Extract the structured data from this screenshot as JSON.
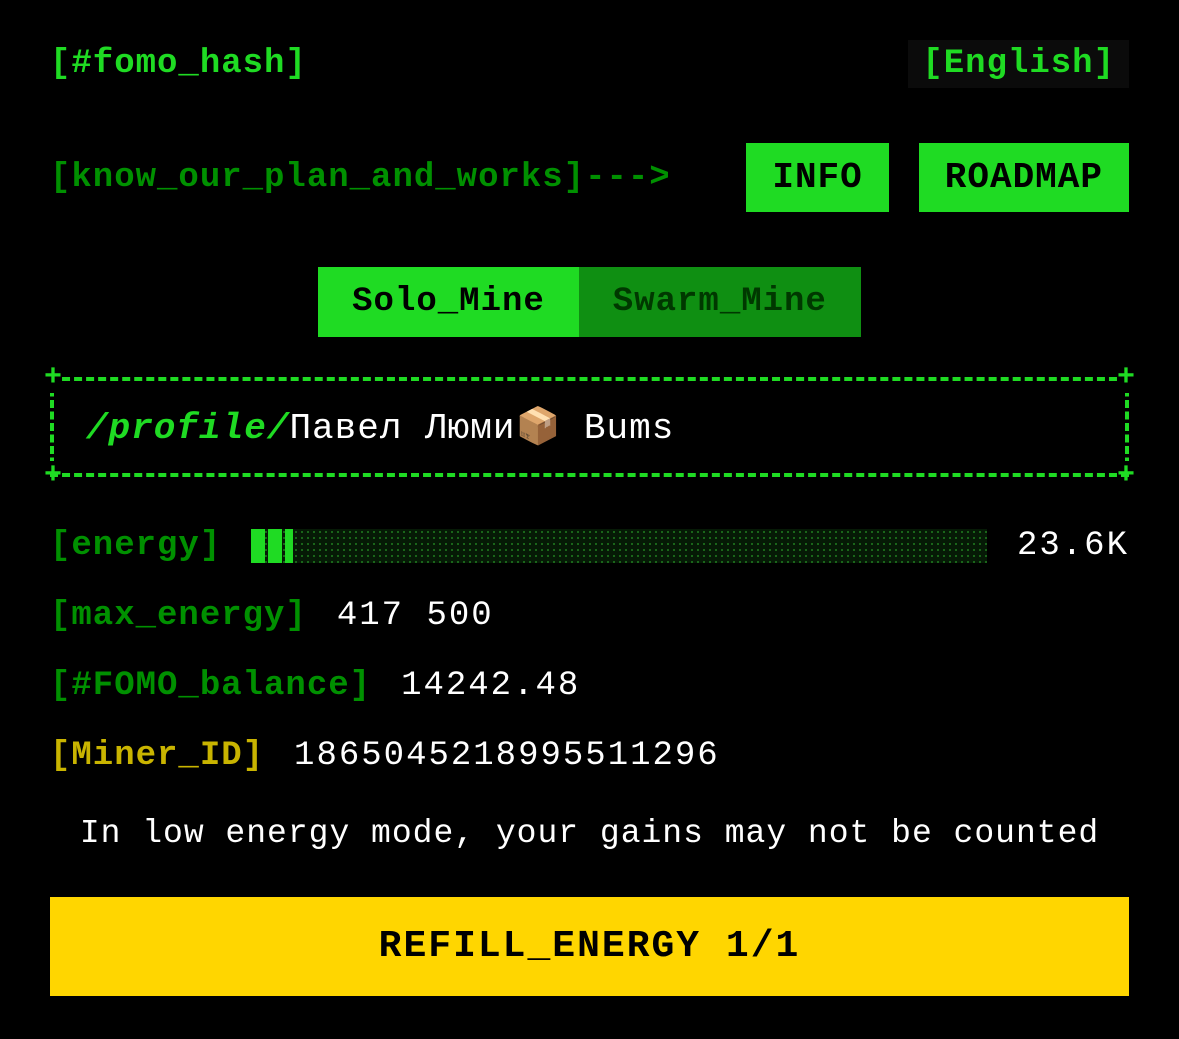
{
  "header": {
    "logo": "[#fomo_hash]",
    "language": "[English]"
  },
  "plan": {
    "label": "[know_our_plan_and_works]--->",
    "info_btn": "INFO",
    "roadmap_btn": "ROADMAP"
  },
  "tabs": {
    "solo": "Solo_Mine",
    "swarm": "Swarm_Mine",
    "active": "solo"
  },
  "profile": {
    "label": "/profile/",
    "name": "Павел Люми📦 Bums"
  },
  "stats": {
    "energy_label": "[energy]",
    "energy_value": "23.6K",
    "energy_current": 23600,
    "energy_max_num": 417500,
    "energy_fill_percent": 5.65,
    "max_energy_label": "[max_energy]",
    "max_energy_value": "417 500",
    "fomo_label": "[#FOMO_balance]",
    "fomo_value": "14242.48",
    "miner_label": "[Miner_ID]",
    "miner_value": "1865045218995511296"
  },
  "warning": "In low energy mode, your gains may not be counted",
  "refill_button": "REFILL_ENERGY 1/1",
  "colors": {
    "bright_green": "#1fdb23",
    "dark_green": "#009000",
    "yellow": "#ffd600",
    "dark_yellow": "#c9b400"
  }
}
